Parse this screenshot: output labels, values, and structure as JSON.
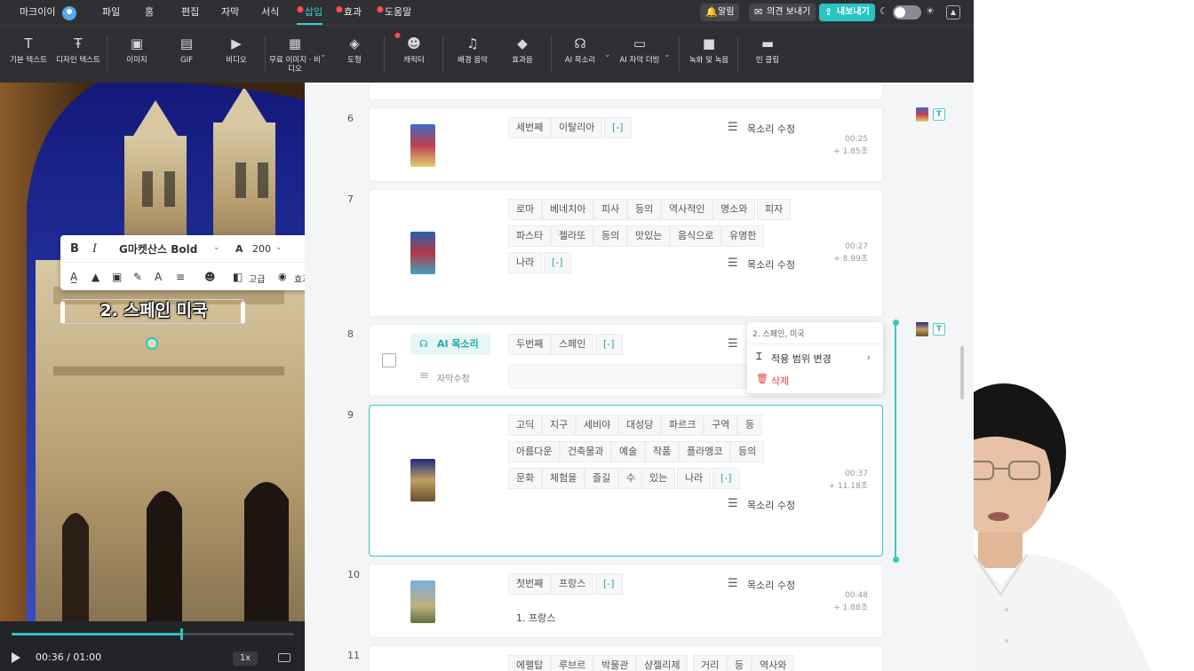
{
  "topmenu": {
    "brand": "마크이이",
    "items": [
      "파일",
      "홈",
      "편집",
      "자막",
      "서식",
      "삽입",
      "효과",
      "도움말"
    ],
    "active": "삽입",
    "alarm": "알림",
    "feedback": "의견 보내기",
    "export": "내보내기"
  },
  "toolbar": {
    "items": [
      {
        "label": "기본 텍스트",
        "icon": "text-icon"
      },
      {
        "label": "디자인 텍스트",
        "icon": "design-text-icon"
      },
      {
        "label": "이미지",
        "icon": "image-icon"
      },
      {
        "label": "GIF",
        "icon": "gif-icon"
      },
      {
        "label": "비디오",
        "icon": "video-icon"
      },
      {
        "label": "무료 이미지 · 비디오",
        "icon": "free-media-icon"
      },
      {
        "label": "도형",
        "icon": "shape-icon"
      },
      {
        "label": "캐릭터",
        "icon": "character-icon"
      },
      {
        "label": "배경 음악",
        "icon": "music-icon"
      },
      {
        "label": "효과음",
        "icon": "sound-effect-icon"
      },
      {
        "label": "AI 목소리",
        "icon": "ai-voice-icon"
      },
      {
        "label": "AI 자막 더빙",
        "icon": "ai-dubbing-icon"
      },
      {
        "label": "녹화 및 녹음",
        "icon": "record-icon"
      },
      {
        "label": "빈 클립",
        "icon": "blank-clip-icon"
      }
    ]
  },
  "textbar": {
    "bold": "B",
    "italic": "I",
    "font": "G마켓산스 Bold",
    "size_icon": "A",
    "size": "200",
    "advanced": "고급",
    "effect": "효과"
  },
  "subtitle_overlay": "2. 스페인 미국",
  "player": {
    "time": "00:36 / 01:00",
    "speed": "1x",
    "progress": 0.6
  },
  "scenes": [
    {
      "num": "6",
      "chips": [
        "세번째",
        "이탈리아",
        "[-]"
      ],
      "voice": "목소리 수정",
      "time": "00:25",
      "dur": "+ 1.85초"
    },
    {
      "num": "7",
      "chips": [
        "로마",
        "베네치아",
        "피사",
        "등의",
        "역사적인",
        "명소와",
        "피자",
        "파스타",
        "젤라또",
        "등의",
        "맛있는",
        "음식으로",
        "유명한",
        "나라",
        "[-]"
      ],
      "voice": "목소리 수정",
      "time": "00:27",
      "dur": "+ 8.99초"
    },
    {
      "num": "8",
      "ai_voice": "AI 목소리",
      "chips": [
        "두번째",
        "스페인",
        "[-]"
      ],
      "sub_edit": "자막수정"
    },
    {
      "num": "9",
      "chips": [
        "고딕",
        "지구",
        "세비야",
        "대성당",
        "파르크",
        "구역",
        "등",
        "아름다운",
        "건축물과",
        "예술",
        "작품",
        "플라멩코",
        "등의",
        "문화",
        "체험을",
        "즐길",
        "수",
        "있는",
        "나라",
        "[-]"
      ],
      "voice": "목소리 수정",
      "time": "00:37",
      "dur": "+ 11.18초"
    },
    {
      "num": "10",
      "chips": [
        "첫번째",
        "프랑스",
        "[-]"
      ],
      "sentence": "1. 프랑스",
      "voice": "목소리 수정",
      "time": "00:48",
      "dur": "+ 1.88초"
    },
    {
      "num": "11",
      "chips": [
        "에펠탑",
        "루브르",
        "박물관",
        "샹젤리제",
        "거리",
        "등",
        "역사와"
      ]
    }
  ],
  "context_menu": {
    "header": "2. 스페인, 미국",
    "scope": "적용 범위 변경",
    "delete": "삭제"
  },
  "colors": {
    "accent": "#2fc3bf",
    "topbar": "#2f3033",
    "danger": "#e04343"
  }
}
